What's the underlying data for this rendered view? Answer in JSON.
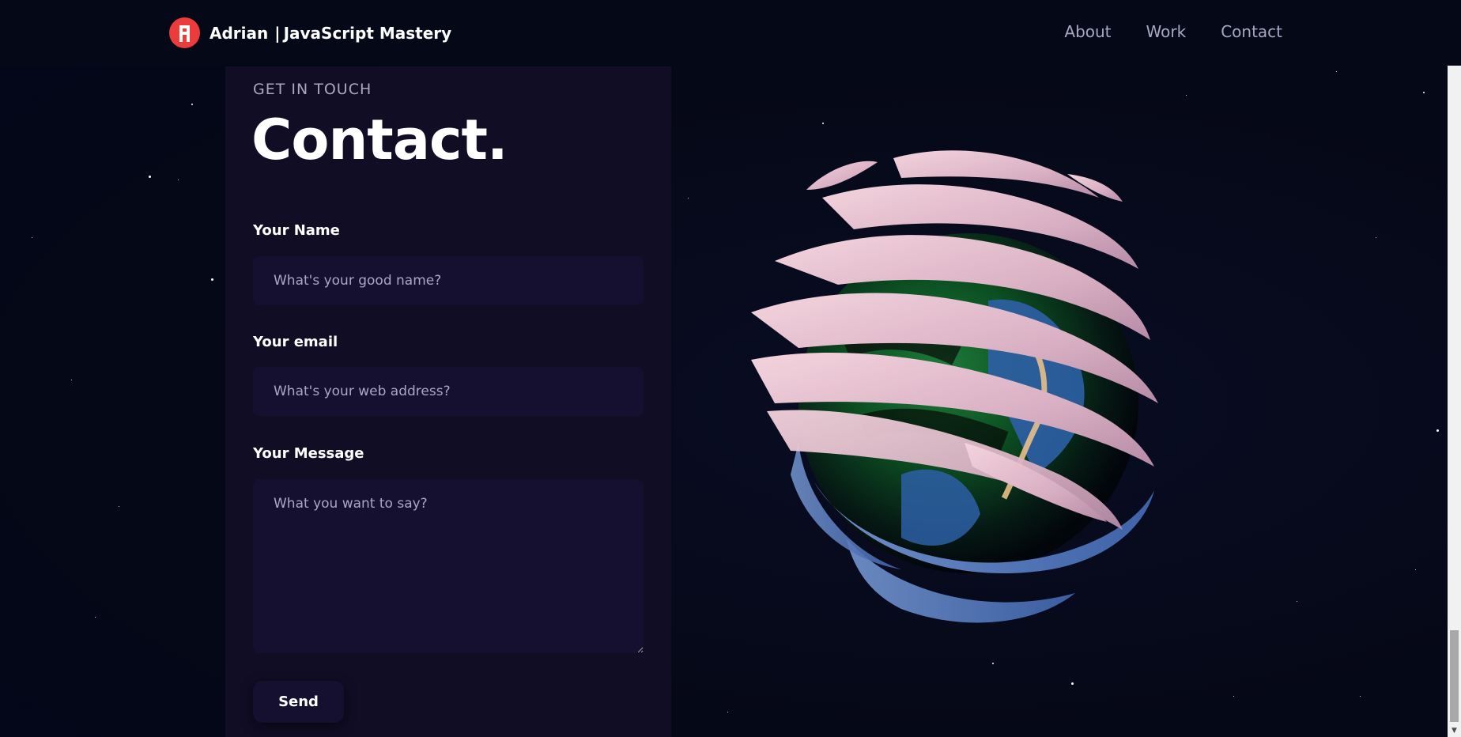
{
  "navbar": {
    "brand_name": "Adrian",
    "brand_suffix": "JavaScript Mastery",
    "links": [
      "About",
      "Work",
      "Contact"
    ]
  },
  "contact": {
    "subtitle": "GET IN TOUCH",
    "title": "Contact.",
    "name_label": "Your Name",
    "name_placeholder": "What's your good name?",
    "email_label": "Your email",
    "email_placeholder": "What's your web address?",
    "message_label": "Your Message",
    "message_placeholder": "What you want to say?",
    "send_label": "Send"
  },
  "colors": {
    "background": "#050816",
    "panel": "#100d25",
    "input": "#151030",
    "secondary_text": "#aaa6c3",
    "logo_red": "#ec3b3b"
  },
  "icons": {
    "logo": "logo-icon",
    "globe": "earth-model"
  }
}
